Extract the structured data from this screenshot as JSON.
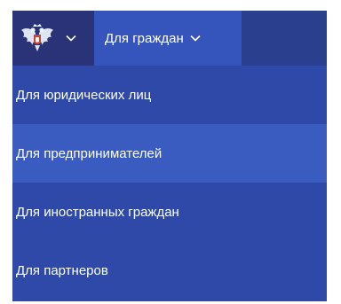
{
  "header": {
    "emblem_icon": "coat-of-arms-icon",
    "citizens_tab_label": "Для граждан"
  },
  "menu": {
    "items": [
      {
        "label": "Для юридических лиц",
        "active": false
      },
      {
        "label": "Для предпринимателей",
        "active": true
      },
      {
        "label": "Для иностранных граждан",
        "active": false
      },
      {
        "label": "Для партнеров",
        "active": false
      }
    ]
  },
  "colors": {
    "menu_background": "#2e49a8",
    "menu_active": "#3a5bbf",
    "topbar": "#2b3f8f",
    "emblem_button": "#2a3377",
    "citizens_tab": "#3555bc",
    "text": "#ffffff"
  }
}
